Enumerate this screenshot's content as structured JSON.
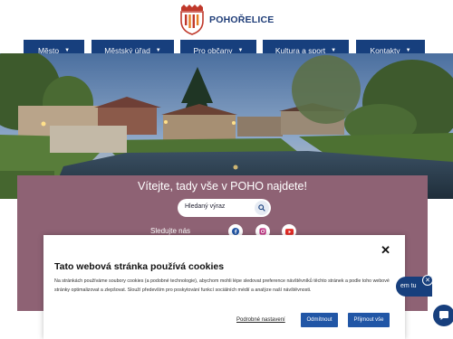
{
  "brand": {
    "name": "POHOŘELICE"
  },
  "nav": {
    "items": [
      {
        "label": "Město"
      },
      {
        "label": "Městský úřad"
      },
      {
        "label": "Pro občany"
      },
      {
        "label": "Kultura a sport"
      },
      {
        "label": "Kontakty"
      }
    ],
    "caret": "▼"
  },
  "hero": {
    "welcome": "Vítejte, tady vše v POHO najdete!",
    "search_placeholder": "Hledaný výraz",
    "follow_label": "Sledujte nás"
  },
  "cookie": {
    "close": "✕",
    "title": "Tato webová stránka používá cookies",
    "text": "Na stránkách používáme soubory cookies (a podobné technologie), abychom mohli lépe sledovat preference návštěvníků těchto stránek a podle toho webové stránky optimalizovat a zlepšovat. Slouží především pro poskytování funkcí sociálních médií a analýze naší návštěvnosti.",
    "settings_label": "Podrobné nastavení",
    "reject_label": "Odmítnout",
    "accept_label": "Přijmout vše"
  },
  "chat": {
    "bubble_text": "em tu",
    "close": "✕"
  },
  "colors": {
    "navy": "#173f7d",
    "band": "#8e6274",
    "button": "#2156a6",
    "logo_red": "#c0392b",
    "logo_orange": "#e67e22"
  }
}
